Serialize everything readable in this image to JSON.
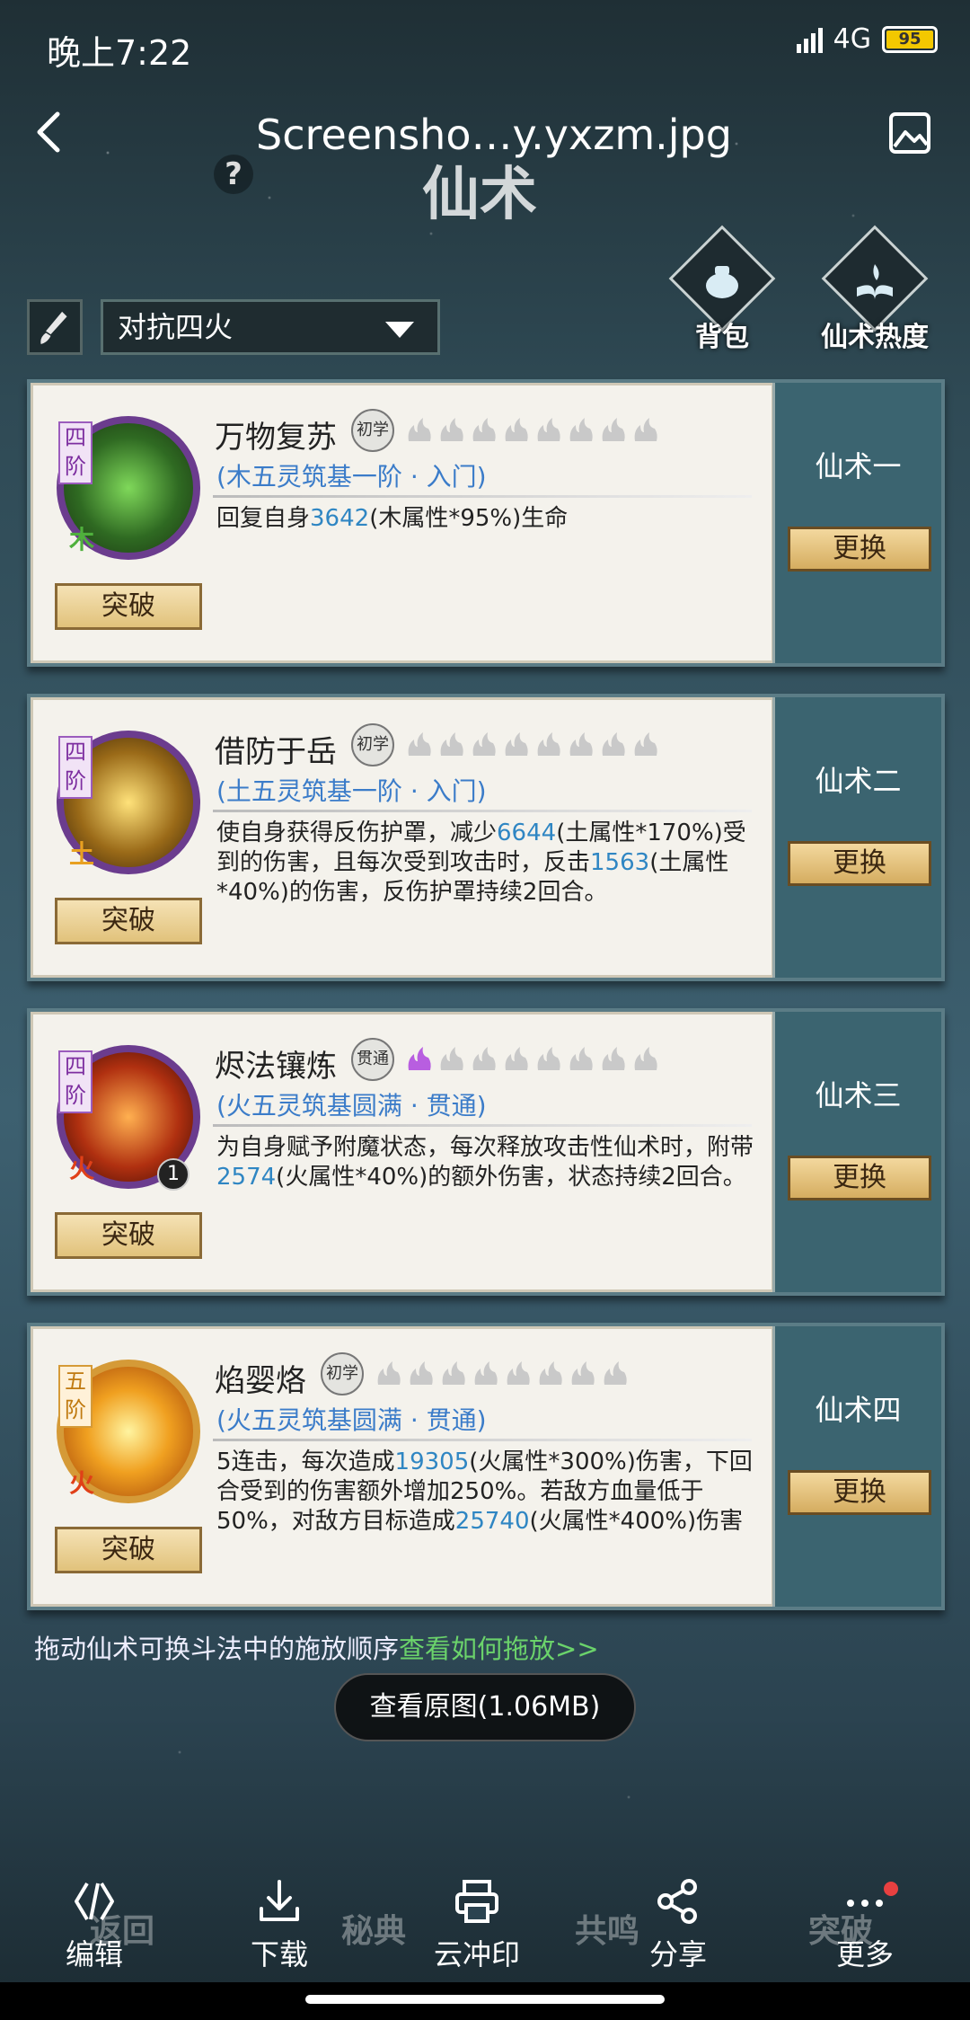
{
  "status_bar": {
    "time": "晚上7:22",
    "network": "4G",
    "battery": "95"
  },
  "viewer": {
    "file_name": "Screensho…y.yxzm.jpg",
    "view_original": "查看原图(1.06MB)"
  },
  "game": {
    "title": "仙术",
    "preset": "对抗四火",
    "bag_label": "背包",
    "heat_label": "仙术热度",
    "drag_hint": "拖动仙术可换斗法中的施放顺序",
    "drag_link": "查看如何拖放>>",
    "bottom_nav": [
      "返回",
      "秘典",
      "共鸣",
      "突破"
    ]
  },
  "cards": [
    {
      "tier": "四阶",
      "element": "木",
      "rank": "初学",
      "name": "万物复苏",
      "sub": "(木五灵筑基一阶 · 入门)",
      "desc_parts": [
        "回复自身",
        "3642",
        "(木属性*95%)生命"
      ],
      "break_label": "突破",
      "slot": "仙术一",
      "replace": "更换",
      "active_flames": 0
    },
    {
      "tier": "四阶",
      "element": "土",
      "rank": "初学",
      "name": "借防于岳",
      "sub": "(土五灵筑基一阶 · 入门)",
      "desc_parts": [
        "使自身获得反伤护罩，减少",
        "6644",
        "(土属性*170%)受到的伤害，且每次受到攻击时，反击",
        "1563",
        "(土属性*40%)的伤害，反伤护罩持续2回合。"
      ],
      "break_label": "突破",
      "slot": "仙术二",
      "replace": "更换",
      "active_flames": 0
    },
    {
      "tier": "四阶",
      "element": "火",
      "rank": "贯通",
      "name": "烬法镶炼",
      "sub": "(火五灵筑基圆满 · 贯通)",
      "desc_parts": [
        "为自身赋予附魔状态，每次释放攻击性仙术时，附带",
        "2574",
        "(火属性*40%)的额外伤害，状态持续2回合。"
      ],
      "break_label": "突破",
      "slot": "仙术三",
      "replace": "更换",
      "badge": "1",
      "active_flames": 1
    },
    {
      "tier": "五阶",
      "element": "火",
      "rank": "初学",
      "name": "焰婴烙",
      "sub": "(火五灵筑基圆满 · 贯通)",
      "desc_parts": [
        "5连击，每次造成",
        "19305",
        "(火属性*300%)伤害，下回合受到的伤害额外增加250%。若敌方血量低于50%，对敌方目标造成",
        "25740",
        "(火属性*400%)伤害"
      ],
      "break_label": "突破",
      "slot": "仙术四",
      "replace": "更换",
      "active_flames": 0
    }
  ],
  "toolbar": {
    "edit": "编辑",
    "download": "下载",
    "print": "云冲印",
    "share": "分享",
    "more": "更多"
  },
  "colors": {
    "accent_number": "#2f86c3",
    "link_green": "#6bd36b",
    "notification_dot": "#e84040"
  }
}
